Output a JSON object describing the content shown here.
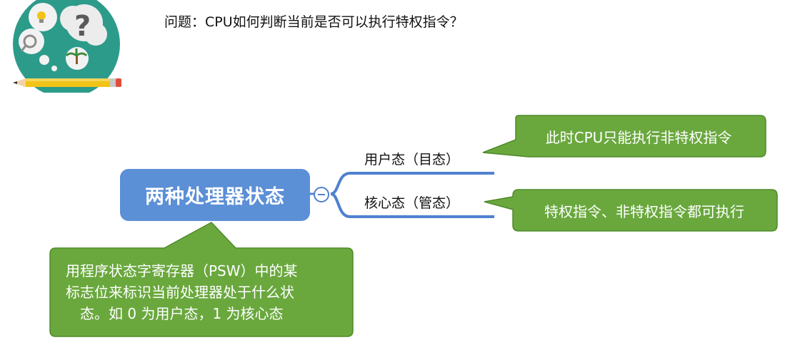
{
  "question": {
    "text": "问题：CPU如何判断当前是否可以执行特权指令？"
  },
  "mindmap": {
    "central_topic": "两种处理器状态",
    "branches": [
      {
        "label": "用户态（目态）"
      },
      {
        "label": "核心态（管态）"
      }
    ],
    "collapse_symbol": "−"
  },
  "callouts": {
    "user_mode": "此时CPU只能执行非特权指令",
    "kernel_mode": "特权指令、非特权指令都可执行",
    "psw": {
      "line1": "用程序状态字寄存器（PSW）中的某",
      "line2": "标志位来标识当前处理器处于什么状",
      "line3": "态。如 0 为用户态，1 为核心态"
    }
  },
  "colors": {
    "central_node": "#5b8fd6",
    "branch_line": "#4f81d0",
    "callout_fill": "#6aa83e",
    "callout_border": "#4e8a2a",
    "illustration_circle": "#2d9b8a",
    "pencil": "#f2c318"
  },
  "icons": {
    "illustration": "question-thinking-illustration",
    "collapse": "collapse-toggle-icon"
  }
}
